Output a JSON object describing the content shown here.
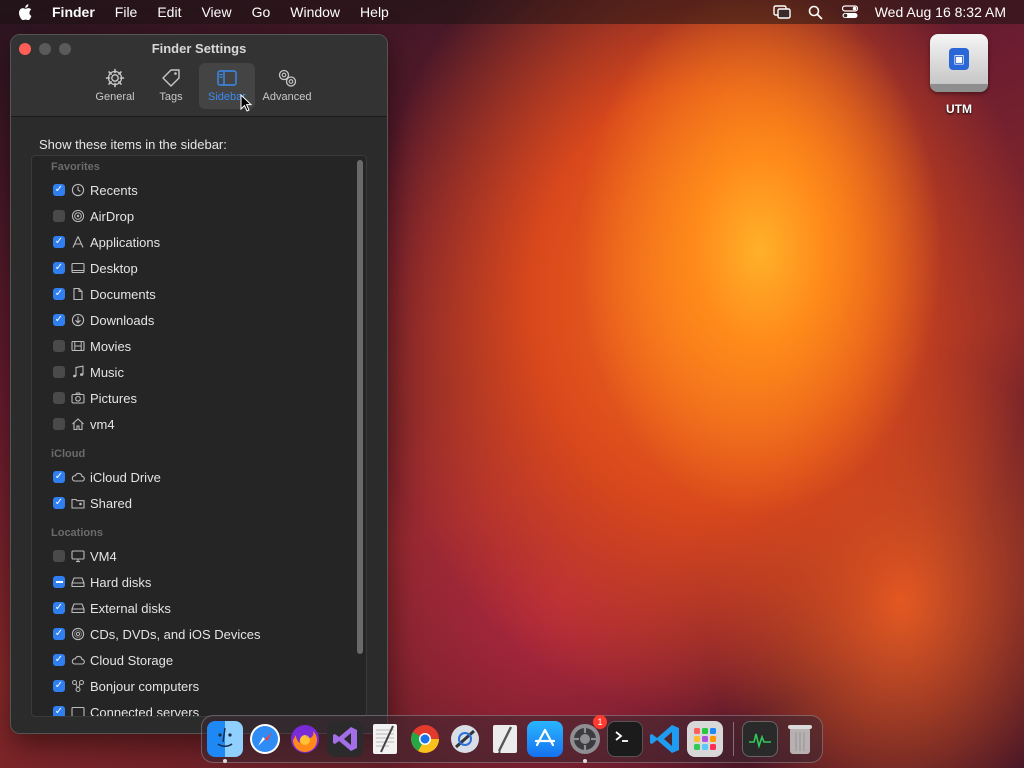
{
  "menubar": {
    "app_name": "Finder",
    "menus": [
      "File",
      "Edit",
      "View",
      "Go",
      "Window",
      "Help"
    ],
    "right_icons": [
      "screen-mirroring-icon",
      "spotlight-search-icon",
      "control-center-icon"
    ],
    "clock": "Wed Aug 16  8:32 AM"
  },
  "desktop": {
    "utm_label": "UTM",
    "utm_glyph": "▣"
  },
  "window": {
    "title": "Finder Settings",
    "tabs": [
      {
        "label": "General",
        "icon": "gear-icon",
        "active": false
      },
      {
        "label": "Tags",
        "icon": "tag-icon",
        "active": false
      },
      {
        "label": "Sidebar",
        "icon": "sidebar-icon",
        "active": true
      },
      {
        "label": "Advanced",
        "icon": "gears-icon",
        "active": false
      }
    ],
    "heading": "Show these items in the sidebar:",
    "sections": {
      "favorites": "Favorites",
      "icloud": "iCloud",
      "locations": "Locations"
    },
    "items": {
      "recents": {
        "label": "Recents",
        "state": "on",
        "icon": "clock-icon"
      },
      "airdrop": {
        "label": "AirDrop",
        "state": "off",
        "icon": "airdrop-icon"
      },
      "applications": {
        "label": "Applications",
        "state": "on",
        "icon": "applications-icon"
      },
      "desktop": {
        "label": "Desktop",
        "state": "on",
        "icon": "desktop-icon"
      },
      "documents": {
        "label": "Documents",
        "state": "on",
        "icon": "document-icon"
      },
      "downloads": {
        "label": "Downloads",
        "state": "on",
        "icon": "download-icon"
      },
      "movies": {
        "label": "Movies",
        "state": "off",
        "icon": "film-icon"
      },
      "music": {
        "label": "Music",
        "state": "off",
        "icon": "music-note-icon"
      },
      "pictures": {
        "label": "Pictures",
        "state": "off",
        "icon": "camera-icon"
      },
      "vm4home": {
        "label": "vm4",
        "state": "off",
        "icon": "home-icon"
      },
      "icloud_drive": {
        "label": "iCloud Drive",
        "state": "on",
        "icon": "cloud-icon"
      },
      "shared": {
        "label": "Shared",
        "state": "on",
        "icon": "shared-folder-icon"
      },
      "vm4computer": {
        "label": "VM4",
        "state": "off",
        "icon": "computer-icon"
      },
      "hard_disks": {
        "label": "Hard disks",
        "state": "mixed",
        "icon": "hard-disk-icon"
      },
      "external_disks": {
        "label": "External disks",
        "state": "on",
        "icon": "external-disk-icon"
      },
      "cds": {
        "label": "CDs, DVDs, and iOS Devices",
        "state": "on",
        "icon": "disc-icon"
      },
      "cloud_storage": {
        "label": "Cloud Storage",
        "state": "on",
        "icon": "cloud-icon"
      },
      "bonjour": {
        "label": "Bonjour computers",
        "state": "on",
        "icon": "bonjour-icon"
      },
      "connected_servers": {
        "label": "Connected servers",
        "state": "on",
        "icon": "server-icon"
      }
    }
  },
  "dock": {
    "apps": [
      {
        "name": "finder-icon",
        "running": true
      },
      {
        "name": "safari-icon",
        "running": false
      },
      {
        "name": "firefox-icon",
        "running": false
      },
      {
        "name": "visual-studio-icon",
        "running": false
      },
      {
        "name": "textedit-icon",
        "running": false
      },
      {
        "name": "chrome-icon",
        "running": false
      },
      {
        "name": "xcode-instruments-icon",
        "running": false
      },
      {
        "name": "script-editor-icon",
        "running": false
      },
      {
        "name": "app-store-icon",
        "running": false
      },
      {
        "name": "system-settings-icon",
        "running": true,
        "badge": "1"
      },
      {
        "name": "terminal-icon",
        "running": false
      },
      {
        "name": "vscode-icon",
        "running": false
      },
      {
        "name": "launchpad-icon",
        "running": false
      },
      {
        "name": "activity-monitor-icon",
        "running": false
      },
      {
        "name": "trash-icon",
        "running": false
      }
    ]
  }
}
